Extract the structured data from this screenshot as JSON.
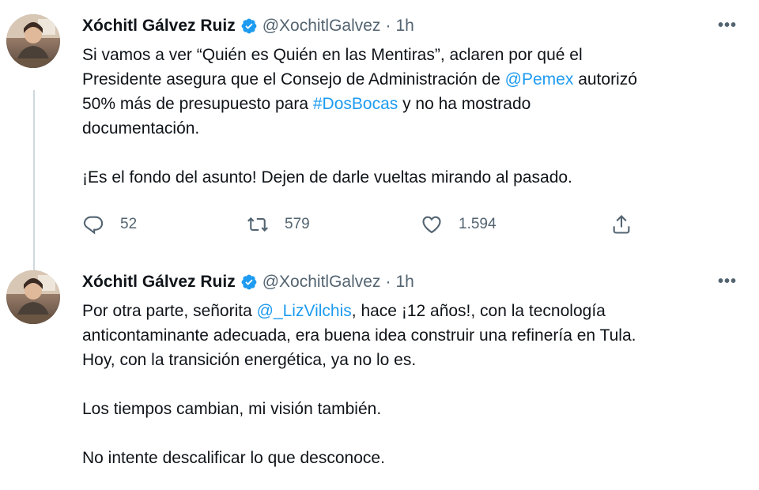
{
  "tweets": [
    {
      "name": "Xóchitl Gálvez Ruiz",
      "handle": "@XochitlGalvez",
      "separator": "·",
      "time": "1h",
      "more": "•••",
      "lines": [
        {
          "a": "Si vamos a ver “Quién es Quién en las Mentiras”, aclaren por qué el"
        },
        {
          "a": "Presidente asegura que el Consejo de Administración de ",
          "link": "@Pemex",
          "b": " autorizó"
        },
        {
          "a": "50% más de presupuesto para ",
          "link": "#DosBocas",
          "b": " y no ha mostrado"
        },
        {
          "a": "documentación."
        },
        {
          "gap": true
        },
        {
          "a": "¡Es el fondo del asunto! Dejen de darle vueltas mirando al pasado."
        }
      ],
      "stats": {
        "replies": "52",
        "retweets": "579",
        "likes": "1.594"
      }
    },
    {
      "name": "Xóchitl Gálvez Ruiz",
      "handle": "@XochitlGalvez",
      "separator": "·",
      "time": "1h",
      "more": "•••",
      "lines": [
        {
          "a": "Por otra parte, señorita ",
          "link": "@_LizVilchis",
          "b": ", hace ¡12 años!, con la tecnología"
        },
        {
          "a": "anticontaminante adecuada, era buena idea construir una refinería en Tula."
        },
        {
          "a": "Hoy, con la transición energética, ya no lo es."
        },
        {
          "gap": true
        },
        {
          "a": "Los tiempos cambian, mi visión también."
        },
        {
          "gap": true
        },
        {
          "a": "No intente descalificar lo que desconoce."
        }
      ]
    }
  ],
  "colors": {
    "link": "#1d9bf0",
    "verified": "#1d9bf0",
    "secondary": "#536471",
    "thread_line": "#cfd9de"
  },
  "icons": {
    "reply": "reply-icon",
    "retweet": "retweet-icon",
    "like": "like-icon",
    "share": "share-icon",
    "verified": "verified-badge-icon",
    "more": "more-icon"
  }
}
